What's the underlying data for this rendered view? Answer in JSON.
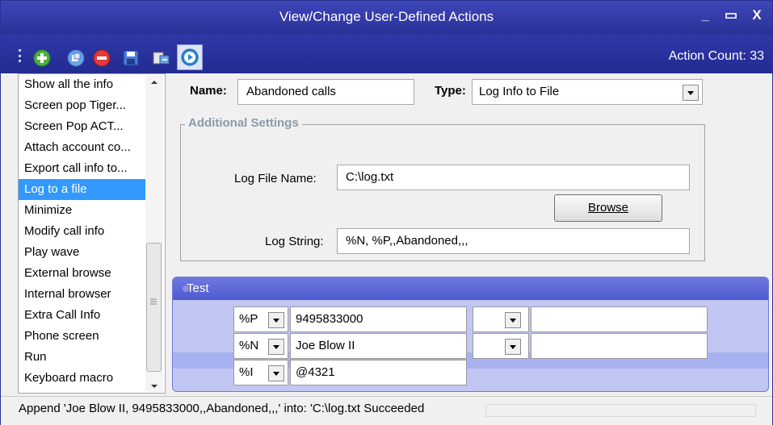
{
  "window": {
    "title": "View/Change User-Defined Actions",
    "minimize_glyph": "_",
    "maximize_glyph": "▭",
    "close_glyph": "X"
  },
  "toolbar": {
    "action_count_label": "Action Count: 33",
    "icons": [
      "add-icon",
      "copy-icon",
      "delete-icon",
      "save-icon",
      "export-icon",
      "run-icon"
    ]
  },
  "actions_list": {
    "items": [
      "Show all the info",
      "Screen pop Tiger...",
      "Screen Pop ACT...",
      "Attach account co...",
      "Export call info to...",
      "Log to a file",
      "Minimize",
      "Modify call info",
      "Play wave",
      "External browse",
      "Internal browser",
      "Extra Call Info",
      "Phone screen",
      "Run",
      "Keyboard macro"
    ],
    "selected": "Log to a file"
  },
  "editor": {
    "name_label": "Name:",
    "name_value": "Abandoned calls",
    "type_label": "Type:",
    "type_value": "Log Info to File"
  },
  "additional_settings": {
    "title": "Additional Settings",
    "log_file_label": "Log File Name:",
    "log_file_value": "C:\\log.txt",
    "browse_label": "Browse",
    "log_string_label": "Log String:",
    "log_string_value": "%N, %P,,Abandoned,,,"
  },
  "test": {
    "title": "Test",
    "rows": [
      {
        "code": "%P",
        "value": "9495833000",
        "code2": "",
        "value2": ""
      },
      {
        "code": "%N",
        "value": "Joe Blow II",
        "code2": "",
        "value2": ""
      },
      {
        "code": "%I",
        "value": "@4321"
      }
    ]
  },
  "status": {
    "text": "Append 'Joe Blow II, 9495833000,,Abandoned,,,' into: 'C:\\log.txt Succeeded"
  },
  "colors": {
    "title_bar": "#2a3298",
    "selection": "#3399ff",
    "test_panel": "#c2c6f2"
  }
}
